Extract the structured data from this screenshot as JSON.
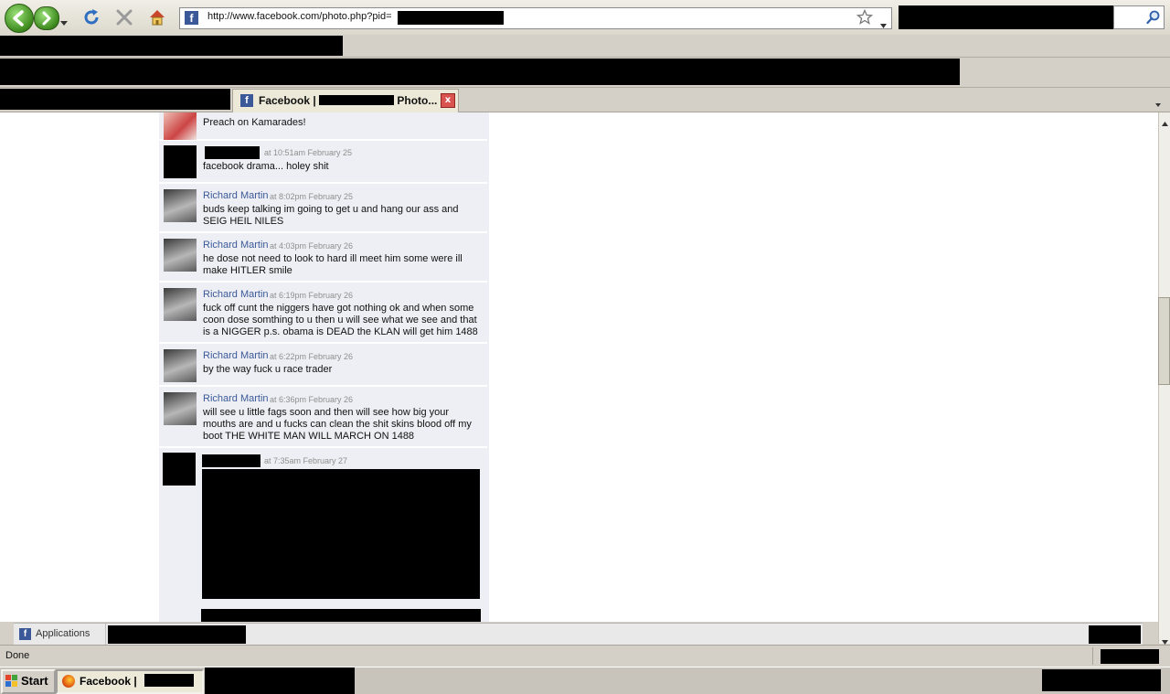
{
  "browser": {
    "url": "http://www.facebook.com/photo.php?pid=",
    "favicon_letter": "f"
  },
  "tab": {
    "title": "Facebook | ",
    "title_suffix": "Photo...",
    "close": "x"
  },
  "comments": [
    {
      "author": "",
      "time": "",
      "text": "Preach on Kamarades!",
      "avatar": "photo"
    },
    {
      "author": "",
      "time": "at 10:51am February 25",
      "text": "facebook drama... holey shit",
      "avatar": "redacted"
    },
    {
      "author": "Richard Martin",
      "time": "at 8:02pm February 25",
      "text": "buds keep talking im going to get u and hang our ass and SEIG HEIL NILES",
      "avatar": "photo"
    },
    {
      "author": "Richard Martin",
      "time": "at 4:03pm February 26",
      "text": "he dose not need to look to hard ill meet him some were ill make HITLER smile",
      "avatar": "photo"
    },
    {
      "author": "Richard Martin",
      "time": "at 6:19pm February 26",
      "text": "fuck off cunt the niggers have got nothing ok and when some coon dose somthing to u then u will see what we see and that is a NIGGER p.s. obama is DEAD the KLAN will get him 1488",
      "avatar": "photo"
    },
    {
      "author": "Richard Martin",
      "time": "at 6:22pm February 26",
      "text": "by the way fuck u race trader",
      "avatar": "photo"
    },
    {
      "author": "Richard Martin",
      "time": "at 6:36pm February 26",
      "text": "will see u little fags soon and then will see how big your mouths are and u fucks can clean the shit skins blood off my boot THE WHITE MAN WILL MARCH ON 1488",
      "avatar": "photo"
    },
    {
      "author": "",
      "time": "at 7:35am February 27",
      "text": "",
      "avatar": "redacted"
    }
  ],
  "fb_bar": {
    "applications_label": "Applications"
  },
  "status": {
    "text": "Done"
  },
  "taskbar": {
    "start_label": "Start",
    "task_label": "Facebook | "
  }
}
